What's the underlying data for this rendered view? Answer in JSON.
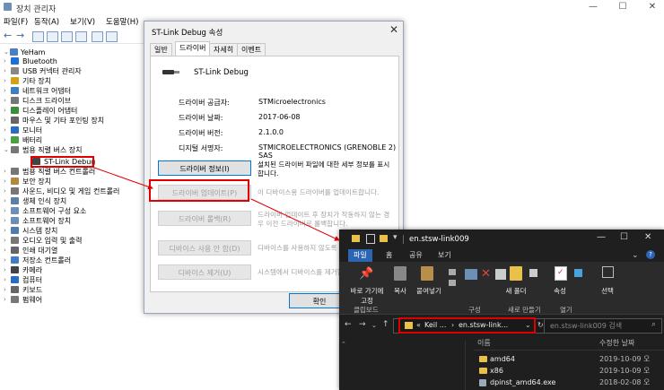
{
  "device_manager": {
    "title": "장치 관리자",
    "window_buttons": [
      "—",
      "☐",
      "✕"
    ],
    "menu": [
      "파일(F)",
      "동작(A)",
      "보기(V)",
      "도움말(H)"
    ],
    "root": "YeHam",
    "tree": [
      {
        "label": "Bluetooth",
        "icon": "bluetooth-icon",
        "color": "#1e6fd9"
      },
      {
        "label": "USB 커넥터 관리자",
        "icon": "usb-icon",
        "color": "#888888"
      },
      {
        "label": "기타 장치",
        "icon": "unknown-device-icon",
        "color": "#d4a017"
      },
      {
        "label": "네트워크 어댑터",
        "icon": "network-icon",
        "color": "#3c7fc4"
      },
      {
        "label": "디스크 드라이브",
        "icon": "disk-icon",
        "color": "#777777"
      },
      {
        "label": "디스플레이 어댑터",
        "icon": "display-icon",
        "color": "#3a8f3a"
      },
      {
        "label": "마우스 및 기타 포인팅 장치",
        "icon": "mouse-icon",
        "color": "#666666"
      },
      {
        "label": "모니터",
        "icon": "monitor-icon",
        "color": "#2a6cc2"
      },
      {
        "label": "배터리",
        "icon": "battery-icon",
        "color": "#4aa043"
      },
      {
        "label": "범용 직렬 버스 장치",
        "icon": "usb-device-icon",
        "color": "#777777"
      },
      {
        "label": "ST-Link Debug",
        "icon": "usb-plug-icon",
        "color": "#444444",
        "child": true
      },
      {
        "label": "범용 직렬 버스 컨트롤러",
        "icon": "usb-controller-icon",
        "color": "#777777"
      },
      {
        "label": "보안 장치",
        "icon": "security-icon",
        "color": "#b08a3a"
      },
      {
        "label": "사운드, 비디오 및 게임 컨트롤러",
        "icon": "sound-icon",
        "color": "#777777"
      },
      {
        "label": "생체 인식 장치",
        "icon": "biometric-icon",
        "color": "#5c7fa8"
      },
      {
        "label": "소프트웨어 구성 요소",
        "icon": "software-component-icon",
        "color": "#6b8fb9"
      },
      {
        "label": "소프트웨어 장치",
        "icon": "software-device-icon",
        "color": "#6b8fb9"
      },
      {
        "label": "시스템 장치",
        "icon": "system-icon",
        "color": "#4f7bb0"
      },
      {
        "label": "오디오 입력 및 출력",
        "icon": "audio-icon",
        "color": "#777777"
      },
      {
        "label": "인쇄 대기열",
        "icon": "printer-icon",
        "color": "#666666"
      },
      {
        "label": "저장소 컨트롤러",
        "icon": "storage-icon",
        "color": "#3f7ec4"
      },
      {
        "label": "카메라",
        "icon": "camera-icon",
        "color": "#444444"
      },
      {
        "label": "컴퓨터",
        "icon": "computer-icon",
        "color": "#2a6cc2"
      },
      {
        "label": "키보드",
        "icon": "keyboard-icon",
        "color": "#666666"
      },
      {
        "label": "펌웨어",
        "icon": "firmware-icon",
        "color": "#777777"
      }
    ]
  },
  "properties": {
    "title": "ST-Link Debug 속성",
    "tabs": [
      "일반",
      "드라이버",
      "자세히",
      "이벤트"
    ],
    "active_tab": "드라이버",
    "device_name": "ST-Link Debug",
    "fields": [
      {
        "key": "드라이버 공급자:",
        "value": "STMicroelectronics"
      },
      {
        "key": "드라이버 날짜:",
        "value": "2017-06-08"
      },
      {
        "key": "드라이버 버전:",
        "value": "2.1.0.0"
      },
      {
        "key": "디지털 서명자:",
        "value": "STMICROELECTRONICS (GRENOBLE 2) SAS"
      }
    ],
    "buttons": [
      {
        "label": "드라이버 정보(I)",
        "desc": "설치된 드라이버 파일에 대한 세부 정보를 표시합니다.",
        "enabled": true
      },
      {
        "label": "드라이버 업데이트(P)",
        "desc": "이 디바이스용 드라이버를 업데이트합니다.",
        "enabled": false
      },
      {
        "label": "드라이버 롤백(R)",
        "desc": "드라이버 업데이트 후 장치가 작동하지 않는 경우 이전 드라이버로 롤백합니다.",
        "enabled": false
      },
      {
        "label": "디바이스 사용 안 함(D)",
        "desc": "디바이스를 사용하지 않도록 설정합니다.",
        "enabled": false
      },
      {
        "label": "디바이스 제거(U)",
        "desc": "시스템에서 디바이스를 제거합니다.",
        "enabled": false
      }
    ],
    "ok_label": "확인"
  },
  "explorer": {
    "title": "en.stsw-link009",
    "window_buttons": [
      "—",
      "☐",
      "✕"
    ],
    "tabs": [
      "파일",
      "홈",
      "공유",
      "보기"
    ],
    "ribbon": {
      "pin_label": "바로 가기에 고정",
      "copy_label": "복사",
      "paste_label": "붙여넣기",
      "new_folder_label": "새 폴더",
      "properties_label": "속성",
      "select_label": "선택",
      "groups": [
        "클립보드",
        "구성",
        "새로 만들기",
        "열기"
      ]
    },
    "address": {
      "segments": [
        "Keil ...",
        "en.stsw-link..."
      ]
    },
    "search_placeholder": "en.stsw-link009 검색",
    "columns": {
      "name": "이름",
      "modified": "수정한 날짜"
    },
    "files": [
      {
        "name": "amd64",
        "date": "2019-10-09 오",
        "type": "folder"
      },
      {
        "name": "x86",
        "date": "2019-10-09 오",
        "type": "folder"
      },
      {
        "name": "dpinst_amd64.exe",
        "date": "2018-02-08 오",
        "type": "exe"
      }
    ]
  },
  "colors": {
    "highlight": "#e00000",
    "explorer_bg": "#1f1f1f",
    "ribbon_active": "#2b65b3"
  }
}
